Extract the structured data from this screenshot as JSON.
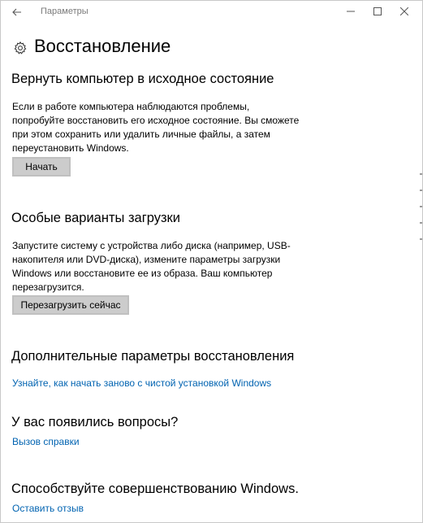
{
  "titlebar": {
    "app_title": "Параметры",
    "icons": [
      "back-arrow-icon",
      "minimize-icon",
      "maximize-icon",
      "close-icon"
    ]
  },
  "header": {
    "title": "Восстановление",
    "icon": "gear-icon"
  },
  "reset_section": {
    "heading": "Вернуть компьютер в исходное состояние",
    "lines": [
      "Если в работе компьютера наблюдаются проблемы,",
      "попробуйте восстановить его исходное состояние. Вы сможете",
      "при этом сохранить или удалить личные файлы, а затем",
      "переустановить Windows."
    ],
    "button_label": "Начать"
  },
  "startup_section": {
    "heading": "Особые варианты загрузки",
    "lines": [
      "Запустите систему с устройства либо диска (например, USB-",
      "накопителя или DVD-диска), измените параметры загрузки",
      "Windows или восстановите ее из образа. Ваш компьютер",
      "перезагрузится."
    ],
    "button_label": "Перезагрузить сейчас"
  },
  "advanced_section": {
    "heading": "Дополнительные параметры восстановления",
    "link": "Узнайте, как начать заново с чистой установкой Windows"
  },
  "questions_section": {
    "heading": "У вас появились вопросы?",
    "link": "Вызов справки"
  },
  "feedback_section": {
    "heading": "Способствуйте совершенствованию Windows.",
    "link": "Оставить отзыв"
  },
  "colors": {
    "accent_link": "#0063b1",
    "button_bg": "#cccccc",
    "title_gray": "#7a7a7a"
  }
}
